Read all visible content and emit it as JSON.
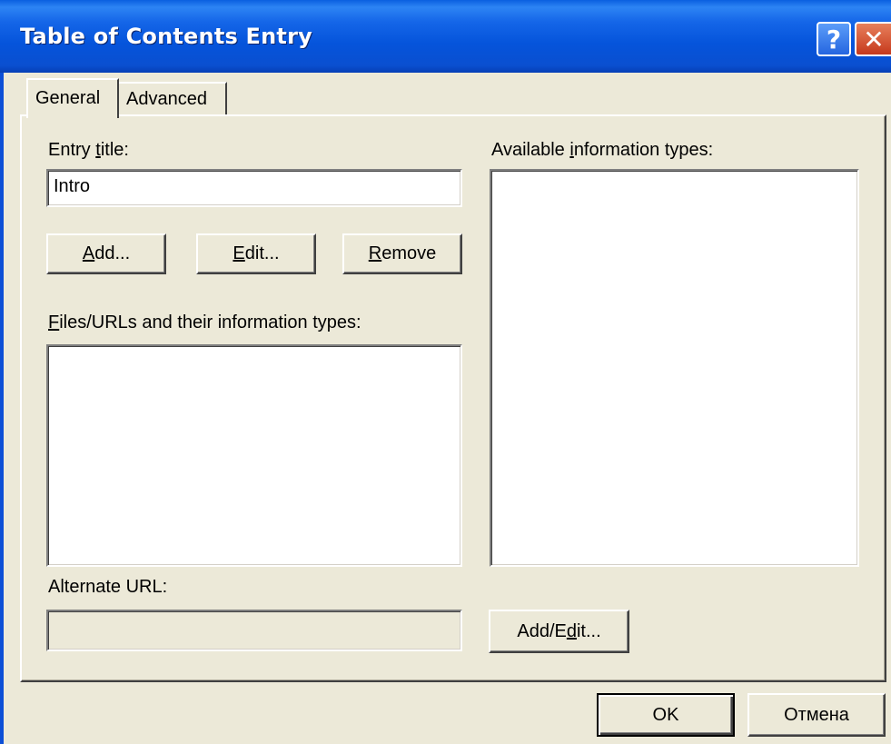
{
  "window": {
    "title": "Table of Contents Entry",
    "help_glyph": "?",
    "close_glyph": "✕"
  },
  "tabs": [
    {
      "label": "General",
      "selected": true
    },
    {
      "label": "Advanced",
      "selected": false
    }
  ],
  "general": {
    "entry_title_label": {
      "pre": "Entry ",
      "key": "t",
      "post": "itle:"
    },
    "entry_title_value": "Intro",
    "add_button": {
      "key": "A",
      "post": "dd..."
    },
    "edit_button": {
      "key": "E",
      "post": "dit..."
    },
    "remove_button": {
      "key": "R",
      "post": "emove"
    },
    "files_label": {
      "key": "F",
      "post": "iles/URLs and their information types:"
    },
    "files_list": [],
    "available_label": {
      "pre": "Available ",
      "key": "i",
      "post": "nformation types:"
    },
    "available_list": [],
    "alternate_url_label": "Alternate URL:",
    "alternate_url_value": "",
    "add_edit_button": {
      "pre": "Add/E",
      "key": "d",
      "post": "it..."
    }
  },
  "footer": {
    "ok_label": "OK",
    "cancel_label": "Отмена"
  }
}
